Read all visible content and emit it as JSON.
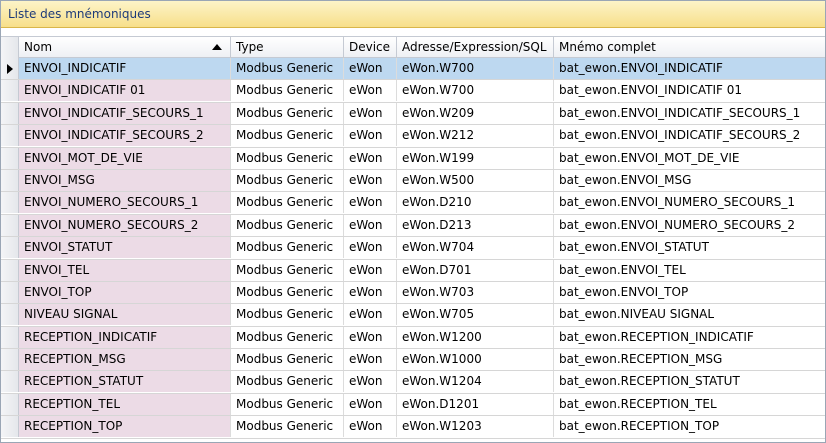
{
  "panel": {
    "title": "Liste des mnémoniques"
  },
  "columns": {
    "nom": "Nom",
    "type": "Type",
    "device": "Device",
    "adresse": "Adresse/Expression/SQL",
    "mnemo": "Mnémo complet"
  },
  "rows": [
    {
      "nom": "ENVOI_INDICATIF",
      "type": "Modbus Generic",
      "device": "eWon",
      "adresse": "eWon.W700",
      "mnemo": "bat_ewon.ENVOI_INDICATIF"
    },
    {
      "nom": "ENVOI_INDICATIF 01",
      "type": "Modbus Generic",
      "device": "eWon",
      "adresse": "eWon.W700",
      "mnemo": "bat_ewon.ENVOI_INDICATIF 01"
    },
    {
      "nom": "ENVOI_INDICATIF_SECOURS_1",
      "type": "Modbus Generic",
      "device": "eWon",
      "adresse": "eWon.W209",
      "mnemo": "bat_ewon.ENVOI_INDICATIF_SECOURS_1"
    },
    {
      "nom": "ENVOI_INDICATIF_SECOURS_2",
      "type": "Modbus Generic",
      "device": "eWon",
      "adresse": "eWon.W212",
      "mnemo": "bat_ewon.ENVOI_INDICATIF_SECOURS_2"
    },
    {
      "nom": "ENVOI_MOT_DE_VIE",
      "type": "Modbus Generic",
      "device": "eWon",
      "adresse": "eWon.W199",
      "mnemo": "bat_ewon.ENVOI_MOT_DE_VIE"
    },
    {
      "nom": "ENVOI_MSG",
      "type": "Modbus Generic",
      "device": "eWon",
      "adresse": "eWon.W500",
      "mnemo": "bat_ewon.ENVOI_MSG"
    },
    {
      "nom": "ENVOI_NUMERO_SECOURS_1",
      "type": "Modbus Generic",
      "device": "eWon",
      "adresse": "eWon.D210",
      "mnemo": "bat_ewon.ENVOI_NUMERO_SECOURS_1"
    },
    {
      "nom": "ENVOI_NUMERO_SECOURS_2",
      "type": "Modbus Generic",
      "device": "eWon",
      "adresse": "eWon.D213",
      "mnemo": "bat_ewon.ENVOI_NUMERO_SECOURS_2"
    },
    {
      "nom": "ENVOI_STATUT",
      "type": "Modbus Generic",
      "device": "eWon",
      "adresse": "eWon.W704",
      "mnemo": "bat_ewon.ENVOI_STATUT"
    },
    {
      "nom": "ENVOI_TEL",
      "type": "Modbus Generic",
      "device": "eWon",
      "adresse": "eWon.D701",
      "mnemo": "bat_ewon.ENVOI_TEL"
    },
    {
      "nom": "ENVOI_TOP",
      "type": "Modbus Generic",
      "device": "eWon",
      "adresse": "eWon.W703",
      "mnemo": "bat_ewon.ENVOI_TOP"
    },
    {
      "nom": "NIVEAU SIGNAL",
      "type": "Modbus Generic",
      "device": "eWon",
      "adresse": "eWon.W705",
      "mnemo": "bat_ewon.NIVEAU SIGNAL"
    },
    {
      "nom": "RECEPTION_INDICATIF",
      "type": "Modbus Generic",
      "device": "eWon",
      "adresse": "eWon.W1200",
      "mnemo": "bat_ewon.RECEPTION_INDICATIF"
    },
    {
      "nom": "RECEPTION_MSG",
      "type": "Modbus Generic",
      "device": "eWon",
      "adresse": "eWon.W1000",
      "mnemo": "bat_ewon.RECEPTION_MSG"
    },
    {
      "nom": "RECEPTION_STATUT",
      "type": "Modbus Generic",
      "device": "eWon",
      "adresse": "eWon.W1204",
      "mnemo": "bat_ewon.RECEPTION_STATUT"
    },
    {
      "nom": "RECEPTION_TEL",
      "type": "Modbus Generic",
      "device": "eWon",
      "adresse": "eWon.D1201",
      "mnemo": "bat_ewon.RECEPTION_TEL"
    },
    {
      "nom": "RECEPTION_TOP",
      "type": "Modbus Generic",
      "device": "eWon",
      "adresse": "eWon.W1203",
      "mnemo": "bat_ewon.RECEPTION_TOP"
    }
  ],
  "selected_row": 0,
  "sort": {
    "column": "nom",
    "direction": "ascending"
  },
  "colors": {
    "title_bg": "#f7df8a",
    "title_text": "#1e3a78",
    "selection": "#bdd8f0",
    "name_cell": "#ecdbe6"
  }
}
